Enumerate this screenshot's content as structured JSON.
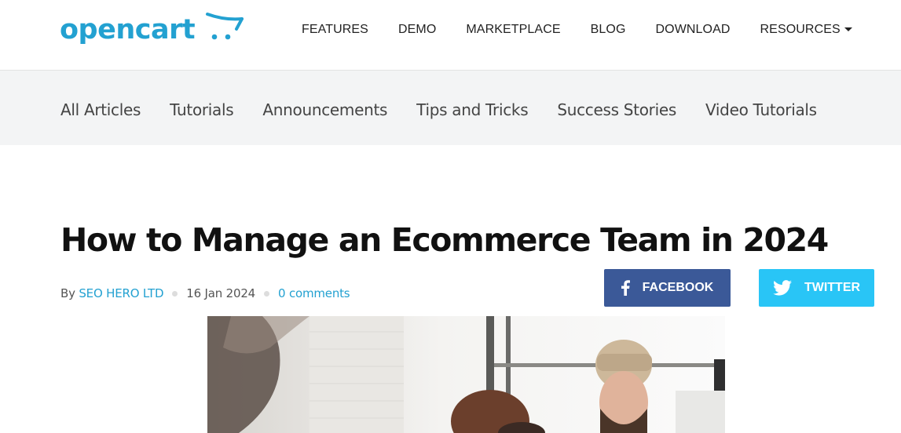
{
  "brand": {
    "name": "opencart",
    "color": "#23a1d1"
  },
  "main_nav": [
    {
      "label": "FEATURES"
    },
    {
      "label": "DEMO"
    },
    {
      "label": "MARKETPLACE"
    },
    {
      "label": "BLOG"
    },
    {
      "label": "DOWNLOAD"
    },
    {
      "label": "RESOURCES",
      "has_dropdown": true
    }
  ],
  "categories": [
    {
      "label": "All Articles"
    },
    {
      "label": "Tutorials"
    },
    {
      "label": "Announcements"
    },
    {
      "label": "Tips and Tricks"
    },
    {
      "label": "Success Stories"
    },
    {
      "label": "Video Tutorials"
    }
  ],
  "article": {
    "title": "How to Manage an Ecommerce Team in 2024",
    "by_prefix": "By",
    "author": "SEO HERO LTD",
    "date": "16 Jan 2024",
    "comments": "0 comments"
  },
  "share": {
    "facebook": {
      "label": "FACEBOOK",
      "icon": "facebook-icon",
      "color": "#3b5998"
    },
    "twitter": {
      "label": "TWITTER",
      "icon": "twitter-bird-icon",
      "color": "#29c5f6"
    }
  }
}
